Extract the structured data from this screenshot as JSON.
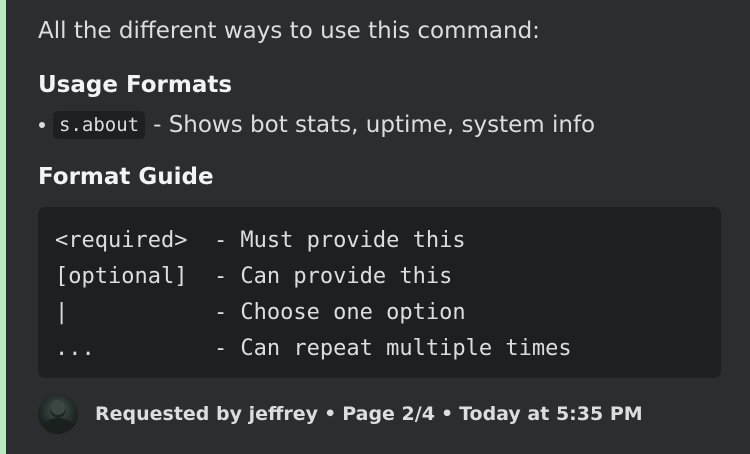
{
  "embed": {
    "accent_color": "#b5ecc0",
    "description": "All the different ways to use this command:",
    "usage_heading": "Usage Formats",
    "usage": {
      "command": "s.about",
      "text": "- Shows bot stats, uptime, system info"
    },
    "guide_heading": "Format Guide",
    "guide_lines": [
      "<required>  - Must provide this",
      "[optional]  - Can provide this",
      "|           - Choose one option",
      "...         - Can repeat multiple times"
    ],
    "footer": {
      "avatar_icon": "user-avatar",
      "requested_by": "Requested by jeffrey",
      "separator": "•",
      "page": "Page 2/4",
      "timestamp": "Today at 5:35 PM"
    }
  }
}
